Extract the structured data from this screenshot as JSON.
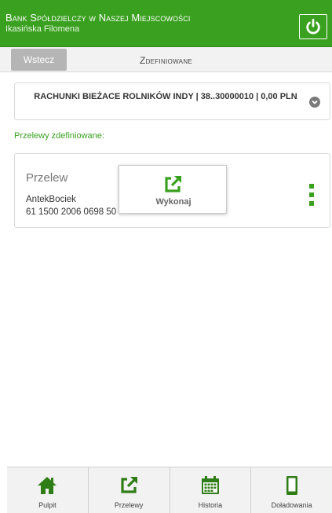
{
  "header": {
    "bank_name": "Bank Spółdzielczy w Naszej Miejscowości",
    "user_name": "Ikasińska Filomena",
    "logout_icon": "power-icon",
    "color": "#3aa020"
  },
  "subnav": {
    "back_label": "Wstecz",
    "title": "Zdefiniowane"
  },
  "account": {
    "label": "RACHUNKI BIEŻACE ROLNIKÓW INDY | 38..30000010 | 0,00 PLN"
  },
  "section_label": "Przelewy zdefiniowane:",
  "transfer": {
    "title": "Przelew",
    "recipient": "AntekBociek",
    "account_number": "61 1500 2006 0698 50"
  },
  "popup": {
    "label": "Wykonaj",
    "icon": "external-link-icon"
  },
  "bottom_nav": {
    "items": [
      {
        "label": "Pulpit",
        "icon": "home-icon"
      },
      {
        "label": "Przelewy",
        "icon": "external-link-icon"
      },
      {
        "label": "Historia",
        "icon": "calendar-icon"
      },
      {
        "label": "Doładowania",
        "icon": "phone-icon"
      }
    ]
  }
}
